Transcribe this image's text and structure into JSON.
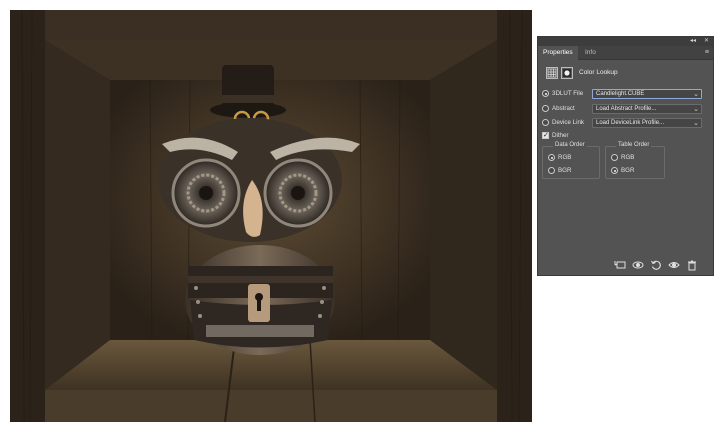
{
  "panel": {
    "tabs": [
      {
        "label": "Properties",
        "active": true
      },
      {
        "label": "Info",
        "active": false
      }
    ],
    "top_controls": {
      "collapse": "◂◂",
      "close": "✕"
    },
    "menu_glyph": "≡",
    "header": {
      "title": "Color Lookup",
      "icons": [
        "adjustment-layer-icon",
        "mask-icon"
      ]
    },
    "options": [
      {
        "label": "3DLUT File",
        "selected": true,
        "value": "Candlelight.CUBE"
      },
      {
        "label": "Abstract",
        "selected": false,
        "value": "Load Abstract Profile..."
      },
      {
        "label": "Device Link",
        "selected": false,
        "value": "Load DeviceLink Profile..."
      }
    ],
    "dither": {
      "label": "Dither",
      "checked": true
    },
    "data_order": {
      "title": "Data Order",
      "options": [
        {
          "label": "RGB",
          "selected": true
        },
        {
          "label": "BGR",
          "selected": false
        }
      ]
    },
    "table_order": {
      "title": "Table Order",
      "options": [
        {
          "label": "RGB",
          "selected": false
        },
        {
          "label": "BGR",
          "selected": true
        }
      ]
    },
    "bottom_icons": [
      "clip-to-layer-icon",
      "view-previous-state-icon",
      "reset-icon",
      "visibility-icon",
      "delete-icon"
    ],
    "bottom_glyphs": {
      "clip": "⬚",
      "prev": "◉",
      "reset": "↺",
      "eye": "👁",
      "trash": "🗑"
    },
    "dropdown_chevron": "⌄"
  },
  "colors": {
    "panel_bg": "#535353",
    "tab_bar": "#424242",
    "wood_dark": "#2a2118",
    "wood_light": "#5a4a33",
    "accent_select": "#8ea9d6"
  }
}
